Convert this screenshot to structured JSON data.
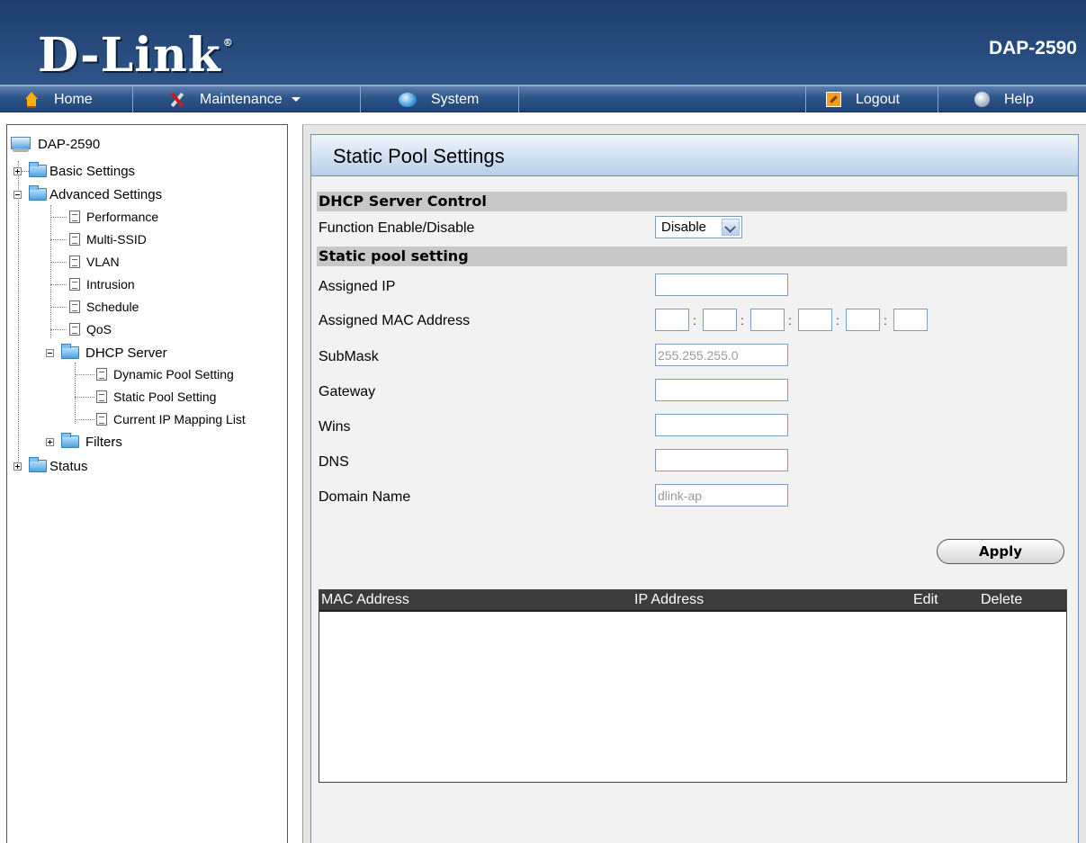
{
  "header": {
    "brand": "D-Link",
    "brand_mark": "®",
    "model": "DAP-2590"
  },
  "menubar": {
    "home": "Home",
    "maintenance": "Maintenance",
    "system": "System",
    "logout": "Logout",
    "help": "Help"
  },
  "sidebar": {
    "root": "DAP-2590",
    "basic_settings": "Basic Settings",
    "advanced_settings": "Advanced Settings",
    "advanced_items": [
      "Performance",
      "Multi-SSID",
      "VLAN",
      "Intrusion",
      "Schedule",
      "QoS"
    ],
    "dhcp_server": "DHCP Server",
    "dhcp_items": [
      "Dynamic Pool Setting",
      "Static Pool Setting",
      "Current IP Mapping List"
    ],
    "filters": "Filters",
    "status": "Status"
  },
  "panel": {
    "title": "Static Pool Settings",
    "dhcp_section": "DHCP Server Control",
    "function_label": "Function Enable/Disable",
    "function_value": "Disable",
    "static_section": "Static pool setting",
    "assigned_ip_label": "Assigned IP",
    "assigned_ip_value": "",
    "assigned_mac_label": "Assigned MAC Address",
    "mac_separator": ":",
    "submask_label": "SubMask",
    "submask_value": "255.255.255.0",
    "gateway_label": "Gateway",
    "gateway_value": "",
    "wins_label": "Wins",
    "wins_value": "",
    "dns_label": "DNS",
    "dns_value": "",
    "domain_label": "Domain Name",
    "domain_value": "dlink-ap",
    "apply_label": "Apply"
  },
  "table": {
    "columns": [
      "MAC Address",
      "IP Address",
      "Edit",
      "Delete"
    ],
    "rows": []
  },
  "colors": {
    "header_bg": "#2d5488",
    "section_bar": "#c8c8c8",
    "table_header": "#3c3c3c"
  }
}
